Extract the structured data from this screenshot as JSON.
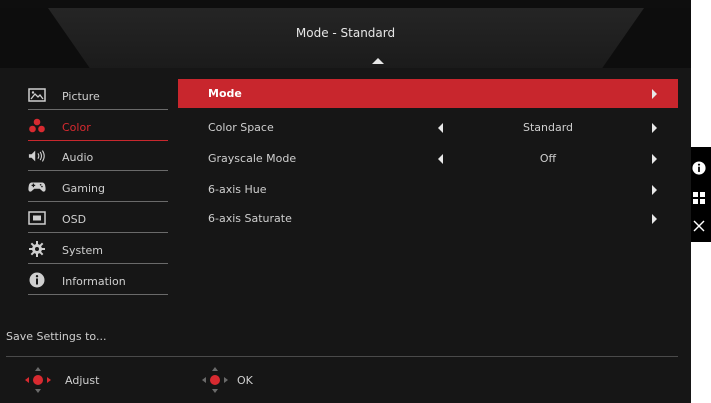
{
  "header": {
    "title": "Mode - Standard"
  },
  "sidebar": {
    "items": [
      {
        "label": "Picture",
        "icon": "picture-icon"
      },
      {
        "label": "Color",
        "icon": "palette-icon",
        "active": true
      },
      {
        "label": "Audio",
        "icon": "speaker-icon"
      },
      {
        "label": "Gaming",
        "icon": "gamepad-icon"
      },
      {
        "label": "OSD",
        "icon": "osd-icon"
      },
      {
        "label": "System",
        "icon": "gear-icon"
      },
      {
        "label": "Information",
        "icon": "info-icon"
      }
    ],
    "save_label": "Save Settings to..."
  },
  "content": {
    "rows": [
      {
        "label": "Mode",
        "value": ""
      },
      {
        "label": "Color Space",
        "value": "Standard"
      },
      {
        "label": "Grayscale Mode",
        "value": "Off"
      },
      {
        "label": "6-axis Hue",
        "value": ""
      },
      {
        "label": "6-axis Saturate",
        "value": ""
      }
    ]
  },
  "footer": {
    "adjust_label": "Adjust",
    "ok_label": "OK"
  },
  "colors": {
    "accent": "#c8262d",
    "background": "#161616",
    "text": "#cfcfcf"
  }
}
